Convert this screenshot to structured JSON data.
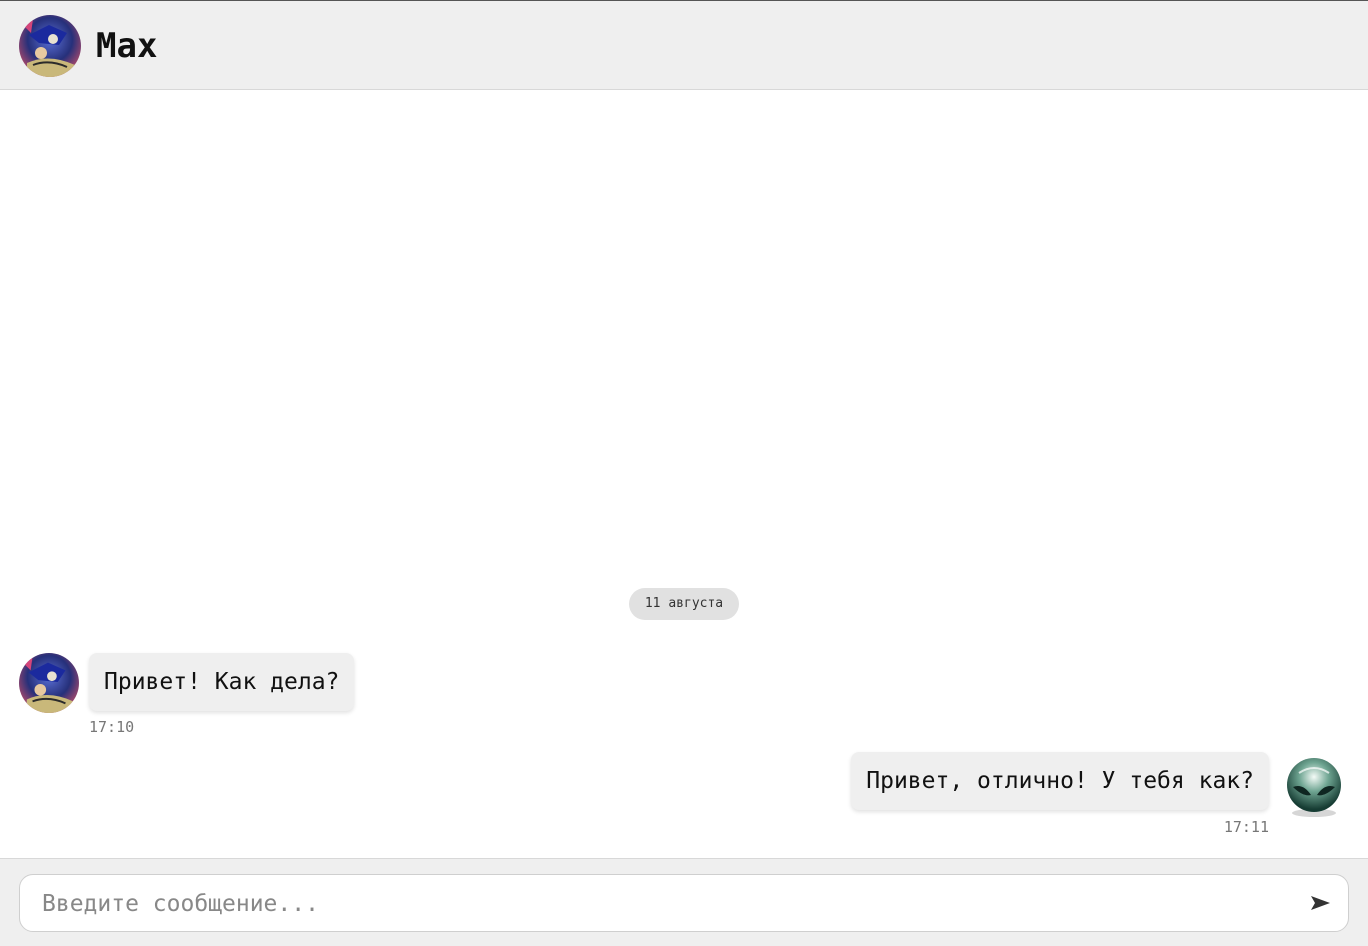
{
  "header": {
    "contact_name": "Max",
    "avatar_icon": "sonic-avatar-icon"
  },
  "messages": {
    "date_separator": "11 августа",
    "items": [
      {
        "direction": "incoming",
        "text": "Привет! Как дела?",
        "time": "17:10",
        "avatar_icon": "sonic-avatar-icon"
      },
      {
        "direction": "outgoing",
        "text": "Привет, отлично! У тебя как?",
        "time": "17:11",
        "avatar_icon": "alien-avatar-icon"
      }
    ]
  },
  "composer": {
    "placeholder": "Введите сообщение...",
    "value": "",
    "send_icon": "send-arrow-icon"
  },
  "colors": {
    "header_bg": "#efefef",
    "bubble_bg": "#efefef",
    "date_pill_bg": "#e1e1e1",
    "time_text": "#777777"
  }
}
